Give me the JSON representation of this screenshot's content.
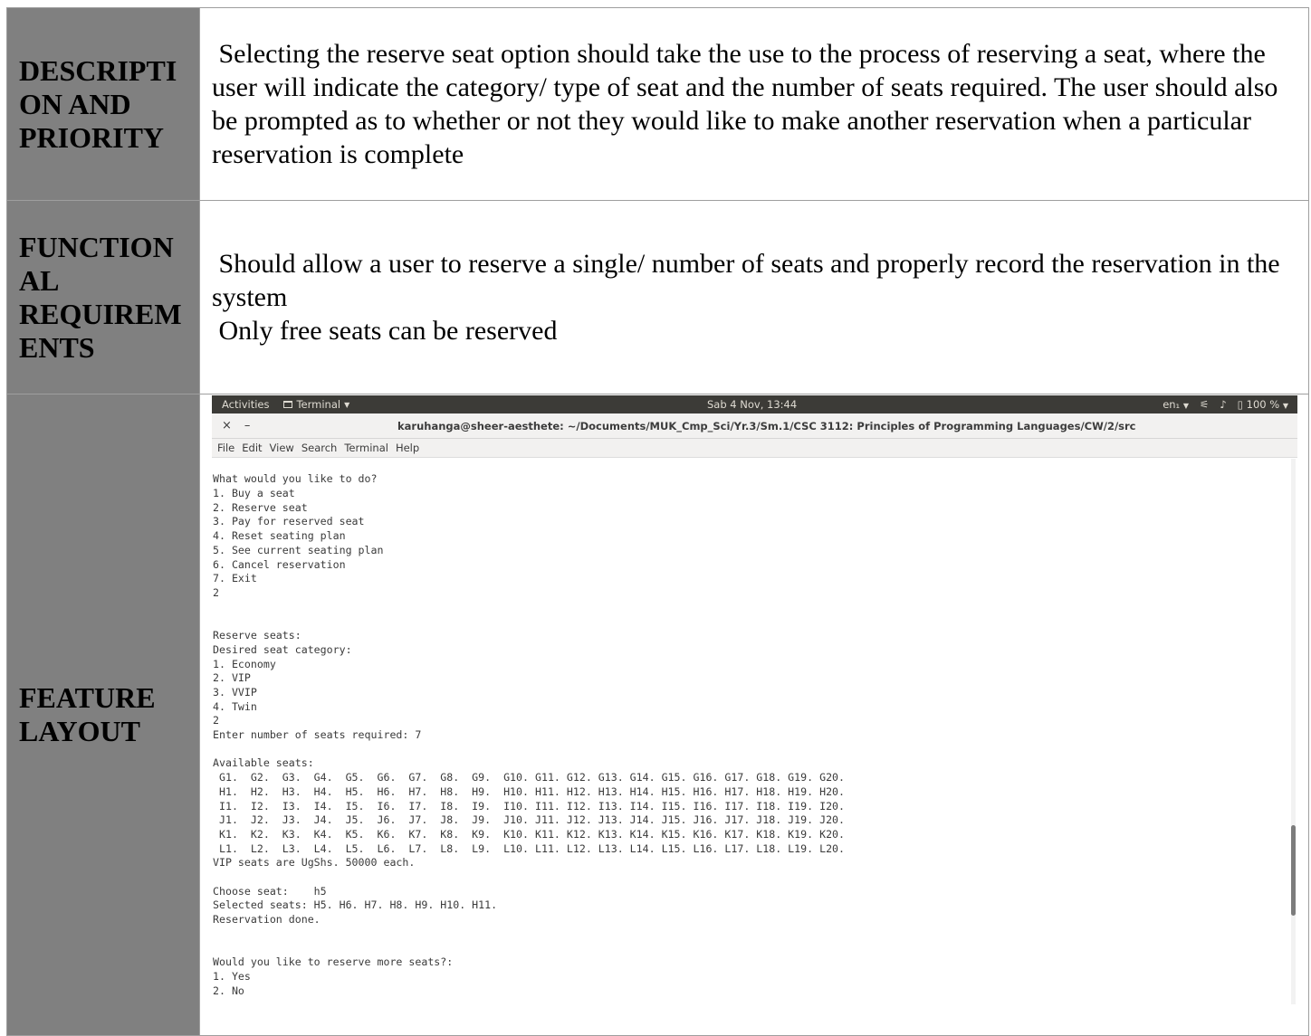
{
  "rows": [
    {
      "label": "DESCRIPTI\nON AND\nPRIORITY",
      "content": " Selecting the reserve seat option should take the use to the process of reserving a seat, where the user will indicate the category/ type of seat and the number of seats required. The user should also be prompted as to whether or not they would like to make another reservation when a particular reservation is complete"
    },
    {
      "label": "FUNCTION\nAL\nREQUIREM\nENTS",
      "content": " Should allow a user to reserve a single/ number of seats and properly record the reservation in the system\n Only free seats can be reserved"
    },
    {
      "label": "FEATURE\nLAYOUT"
    }
  ],
  "screenshot": {
    "topbar": {
      "activities": "Activities",
      "app_menu": "Terminal",
      "clock": "Sab  4 Nov, 13:44",
      "language": "en₁",
      "battery": "100 %"
    },
    "window": {
      "close": "×",
      "minimize": "–",
      "title": "karuhanga@sheer-aesthete: ~/Documents/MUK_Cmp_Sci/Yr.3/Sm.1/CSC 3112: Principles of Programming Languages/CW/2/src"
    },
    "menu": [
      "File",
      "Edit",
      "View",
      "Search",
      "Terminal",
      "Help"
    ],
    "terminal_text": "What would you like to do?\n1. Buy a seat\n2. Reserve seat\n3. Pay for reserved seat\n4. Reset seating plan\n5. See current seating plan\n6. Cancel reservation\n7. Exit\n2\n\n\nReserve seats:\nDesired seat category:\n1. Economy\n2. VIP\n3. VVIP\n4. Twin\n2\nEnter number of seats required: 7\n\nAvailable seats:\n G1.  G2.  G3.  G4.  G5.  G6.  G7.  G8.  G9.  G10. G11. G12. G13. G14. G15. G16. G17. G18. G19. G20.\n H1.  H2.  H3.  H4.  H5.  H6.  H7.  H8.  H9.  H10. H11. H12. H13. H14. H15. H16. H17. H18. H19. H20.\n I1.  I2.  I3.  I4.  I5.  I6.  I7.  I8.  I9.  I10. I11. I12. I13. I14. I15. I16. I17. I18. I19. I20.\n J1.  J2.  J3.  J4.  J5.  J6.  J7.  J8.  J9.  J10. J11. J12. J13. J14. J15. J16. J17. J18. J19. J20.\n K1.  K2.  K3.  K4.  K5.  K6.  K7.  K8.  K9.  K10. K11. K12. K13. K14. K15. K16. K17. K18. K19. K20.\n L1.  L2.  L3.  L4.  L5.  L6.  L7.  L8.  L9.  L10. L11. L12. L13. L14. L15. L16. L17. L18. L19. L20.\nVIP seats are UgShs. 50000 each.\n\nChoose seat:    h5\nSelected seats: H5. H6. H7. H8. H9. H10. H11.\nReservation done.\n\n\nWould you like to reserve more seats?:\n1. Yes\n2. No"
  }
}
